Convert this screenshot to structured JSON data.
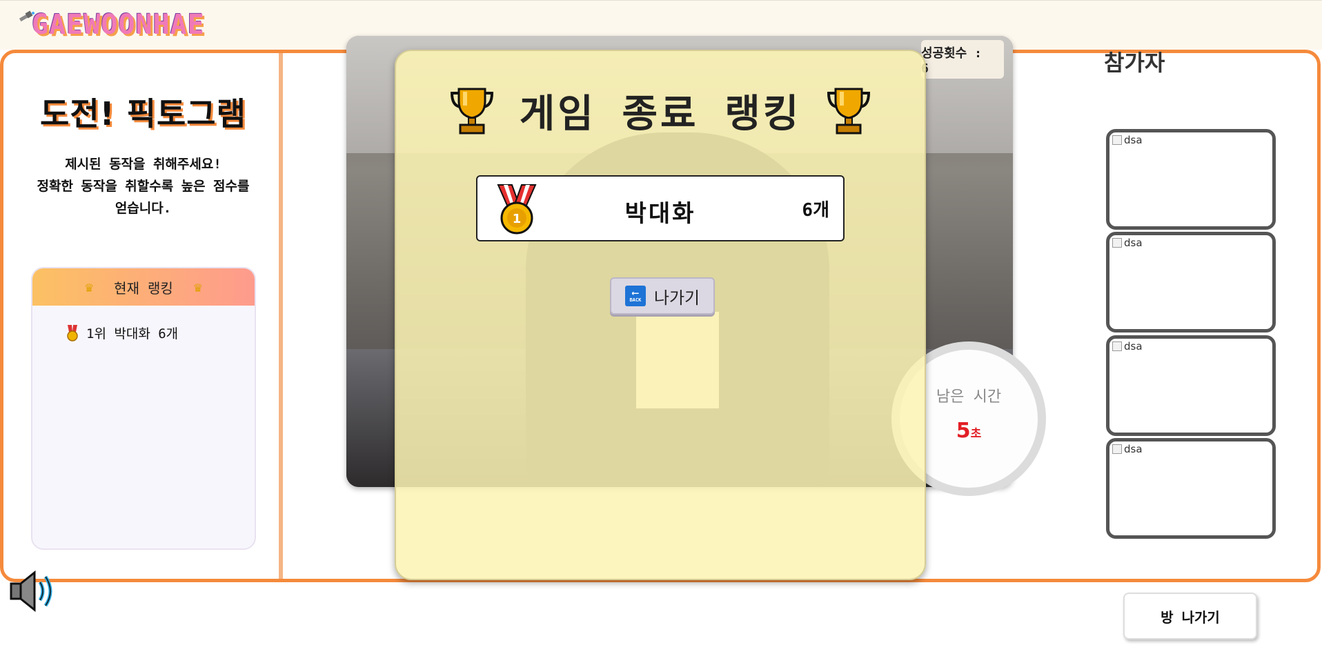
{
  "header": {
    "logo_text": "GAEWOONHAE"
  },
  "left_panel": {
    "title": "도전! 픽토그램",
    "desc_line1": "제시된 동작을 취해주세요!",
    "desc_line2": "정확한 동작을 취할수록 높은 점수를",
    "desc_line3": "얻습니다.",
    "ranking_title": "현재 랭킹",
    "ranking_entries": [
      {
        "text": "1위 박대화 6개"
      }
    ]
  },
  "game": {
    "success_label": "성공횟수 : 6",
    "timer_label": "남은 시간",
    "timer_value": "5",
    "timer_unit": "초"
  },
  "participants": {
    "title": "참가자",
    "items": [
      {
        "alt": "dsa"
      },
      {
        "alt": "dsa"
      },
      {
        "alt": "dsa"
      },
      {
        "alt": "dsa"
      }
    ]
  },
  "modal": {
    "title": "게임 종료 랭킹",
    "results": [
      {
        "name": "박대화",
        "count": "6개"
      }
    ],
    "back_label": "나가기",
    "back_icon_text": "BACK"
  },
  "footer": {
    "leave_room_label": "방 나가기"
  },
  "colors": {
    "accent": "#f58a3c",
    "modal_bg": "#fcf3b2",
    "timer_red": "#e21f26",
    "logo_pink": "#f07ab8"
  }
}
